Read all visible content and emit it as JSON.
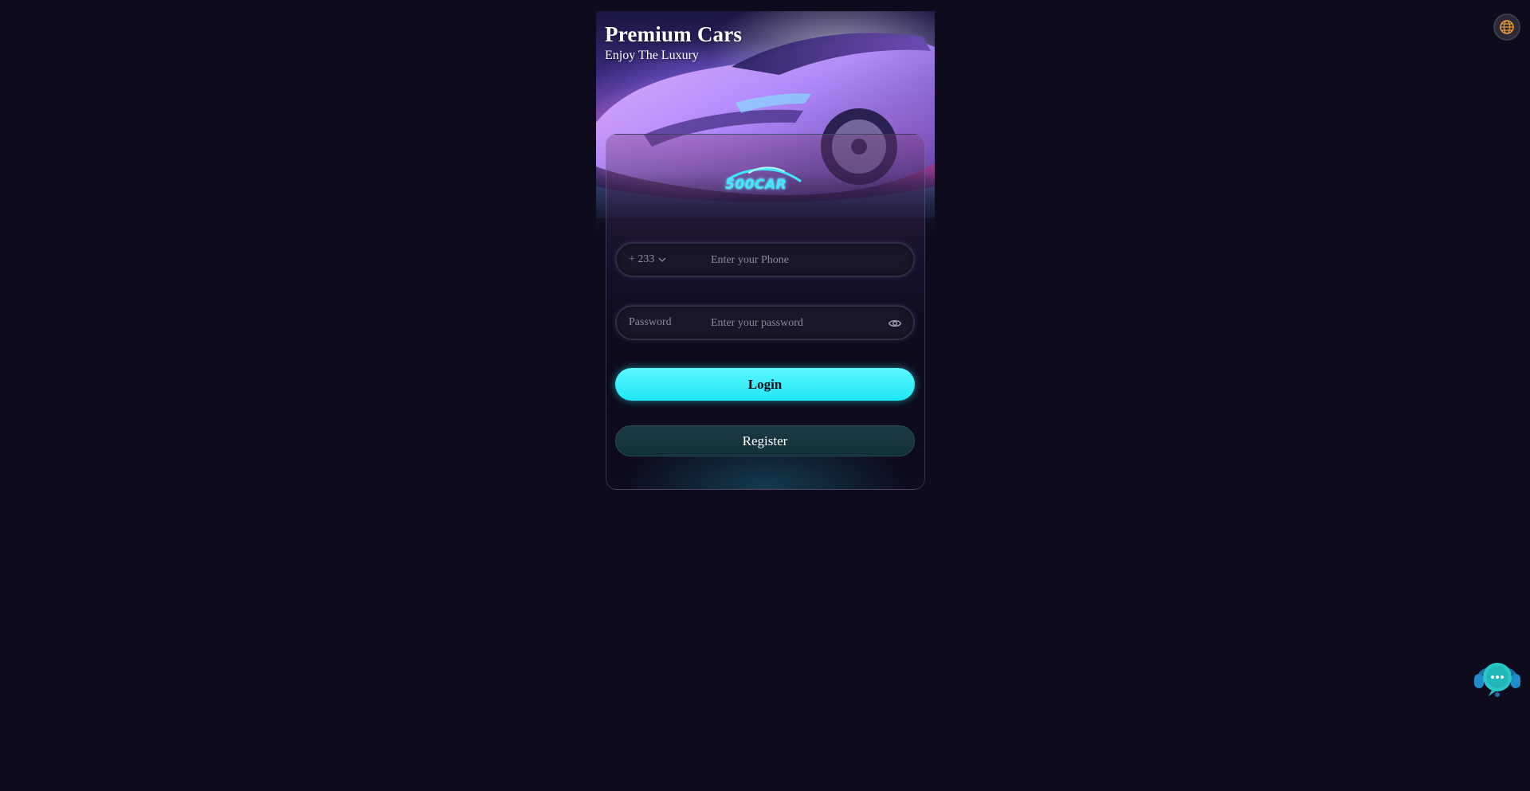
{
  "brand": {
    "title": "Premium Cars",
    "subtitle": "Enjoy The Luxury",
    "logo_text": "500CAR"
  },
  "login_form": {
    "phone": {
      "country_code": "+ 233",
      "placeholder": "Enter your Phone"
    },
    "password": {
      "label": "Password",
      "placeholder": "Enter your password"
    },
    "login_label": "Login",
    "register_label": "Register"
  },
  "icons": {
    "language": "globe-icon",
    "support": "customer-support-chat-icon",
    "password_toggle": "eye-icon",
    "country_dropdown": "chevron-down-icon"
  },
  "colors": {
    "background": "#0e0b1c",
    "accent": "#28e6f5",
    "register_bg": "#163540",
    "globe": "#e8963c"
  }
}
